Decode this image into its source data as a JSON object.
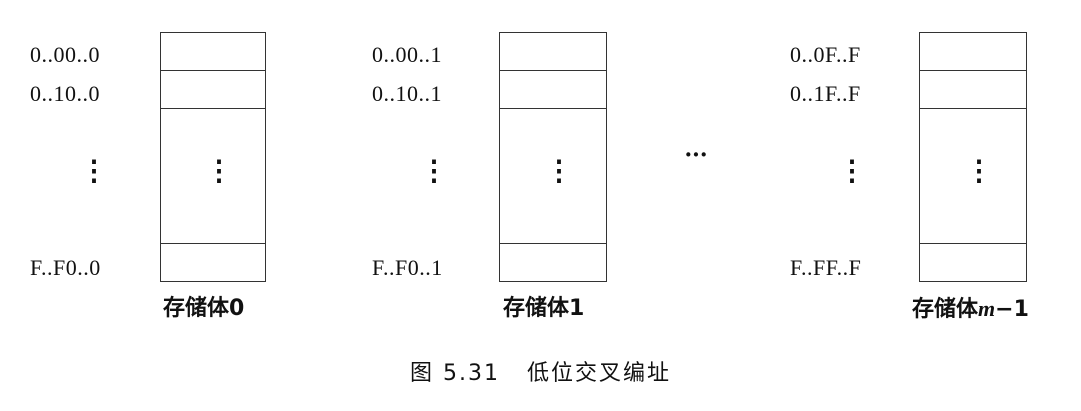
{
  "banks": [
    {
      "name": "存储体0",
      "addresses": {
        "row0": "0..00..0",
        "row1": "0..10..0",
        "last": "F..F0..0"
      },
      "inner_dots": "⋮",
      "outer_dots": "⋮"
    },
    {
      "name": "存储体1",
      "addresses": {
        "row0": "0..00..1",
        "row1": "0..10..1",
        "last": "F..F0..1"
      },
      "inner_dots": "⋮",
      "outer_dots": "⋮"
    },
    {
      "name_prefix": "存储体",
      "name_italic": "m",
      "name_suffix": "−1",
      "addresses": {
        "row0": "0..0F..F",
        "row1": "0..1F..F",
        "last": "F..FF..F"
      },
      "inner_dots": "⋮",
      "outer_dots": "⋮"
    }
  ],
  "between_dots": "···",
  "caption": "图 5.31   低位交叉编址"
}
